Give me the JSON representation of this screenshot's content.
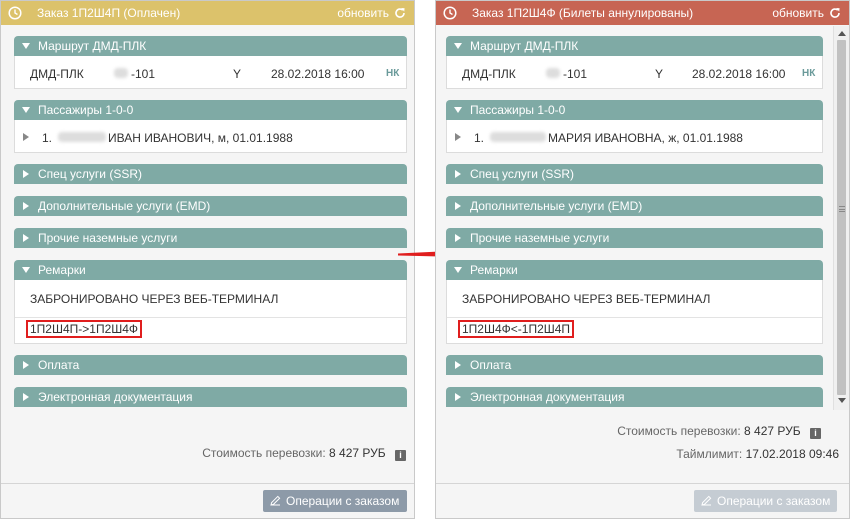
{
  "colors": {
    "header_paid": "#dcc26b",
    "header_cancelled": "#c76553",
    "section_bar": "#7faaa5",
    "highlight_border": "#e01e1e",
    "arrow": "#e01e1e",
    "button_active": "#8d9aa8",
    "button_disabled": "#c5ccd3"
  },
  "icons": {
    "clock": "clock-icon",
    "refresh": "refresh-icon",
    "section_expanded": "triangle-down-icon",
    "section_collapsed": "triangle-right-icon",
    "info": "info-icon",
    "edit": "pencil-icon",
    "transition": "red-arrow-icon"
  },
  "left": {
    "header": {
      "title": "Заказ 1П2Ш4П (Оплачен)",
      "refresh_label": "обновить"
    },
    "route": {
      "title": "Маршрут ДМД-ПЛК",
      "segment": {
        "route": "ДМД-ПЛК",
        "flight": "-101",
        "class": "Y",
        "datetime": "28.02.2018 16:00",
        "status": "НК"
      }
    },
    "passengers": {
      "title": "Пассажиры 1-0-0",
      "item": {
        "index": "1.",
        "name": "ИВАН ИВАНОВИЧ, м, 01.01.1988"
      }
    },
    "sections": {
      "ssr": "Спец услуги (SSR)",
      "emd": "Дополнительные услуги (EMD)",
      "ground": "Прочие наземные услуги",
      "remarks": "Ремарки",
      "payment": "Оплата",
      "docs": "Электронная документация"
    },
    "remarks": {
      "line1": "ЗАБРОНИРОВАНО ЧЕРЕЗ ВЕБ-ТЕРМИНАЛ",
      "line2": "1П2Ш4П->1П2Ш4Ф"
    },
    "footer": {
      "cost_label": "Стоимость перевозки:",
      "cost_value": "8 427 РУБ"
    },
    "button": "Операции с заказом"
  },
  "right": {
    "header": {
      "title": "Заказ 1П2Ш4Ф (Билеты аннулированы)",
      "refresh_label": "обновить"
    },
    "route": {
      "title": "Маршрут ДМД-ПЛК",
      "segment": {
        "route": "ДМД-ПЛК",
        "flight": "-101",
        "class": "Y",
        "datetime": "28.02.2018 16:00",
        "status": "НК"
      }
    },
    "passengers": {
      "title": "Пассажиры 1-0-0",
      "item": {
        "index": "1.",
        "name": "МАРИЯ ИВАНОВНА, ж, 01.01.1988"
      }
    },
    "sections": {
      "ssr": "Спец услуги (SSR)",
      "emd": "Дополнительные услуги (EMD)",
      "ground": "Прочие наземные услуги",
      "remarks": "Ремарки",
      "payment": "Оплата",
      "docs": "Электронная документация"
    },
    "remarks": {
      "line1": "ЗАБРОНИРОВАНО ЧЕРЕЗ ВЕБ-ТЕРМИНАЛ",
      "line2": "1П2Ш4Ф<-1П2Ш4П"
    },
    "footer": {
      "cost_label": "Стоимость перевозки:",
      "cost_value": "8 427 РУБ",
      "timelimit_label": "Таймлимит:",
      "timelimit_value": "17.02.2018 09:46"
    },
    "button": "Операции с заказом"
  }
}
